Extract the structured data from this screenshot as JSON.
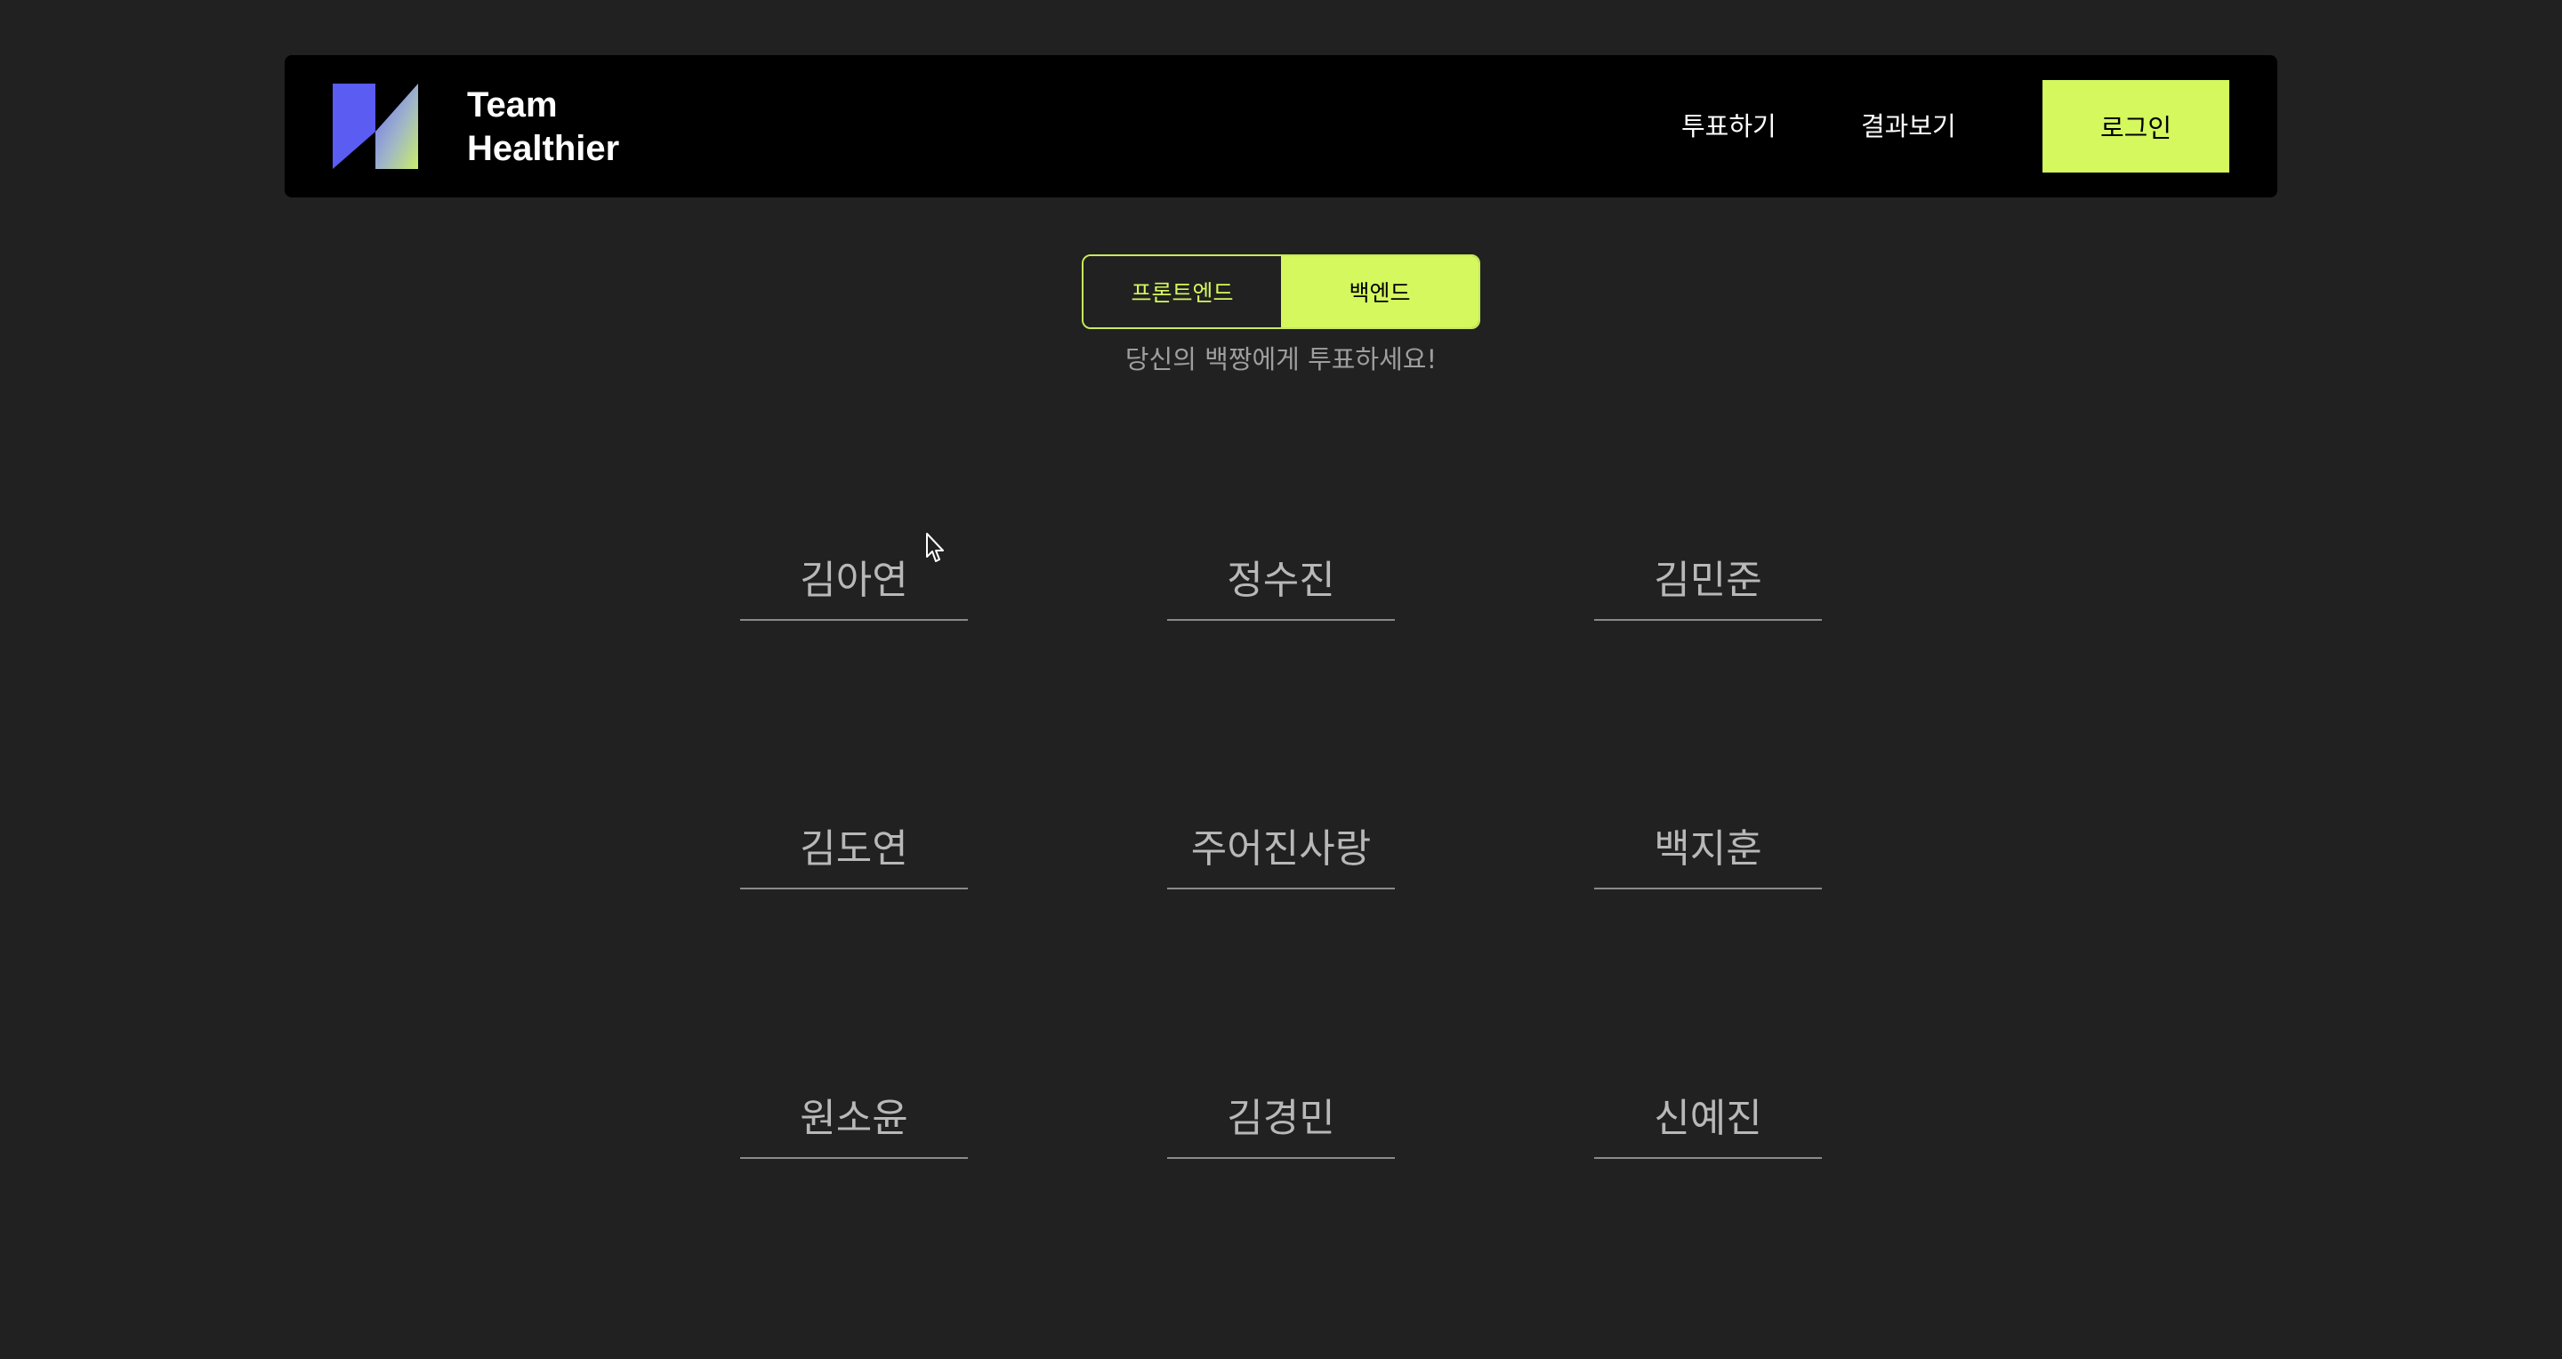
{
  "header": {
    "brand_line1": "Team",
    "brand_line2": "Healthier",
    "nav_vote": "투표하기",
    "nav_results": "결과보기",
    "login_label": "로그인",
    "logo_icon": "team-healthier-logo-icon"
  },
  "toggle": {
    "front_label": "프론트엔드",
    "back_label": "백엔드",
    "selected": "백엔드"
  },
  "subtitle": "당신의 백짱에게 투표하세요!",
  "candidates": [
    {
      "name": "김아연"
    },
    {
      "name": "정수진"
    },
    {
      "name": "김민준"
    },
    {
      "name": "김도연"
    },
    {
      "name": "주어진사랑"
    },
    {
      "name": "백지훈"
    },
    {
      "name": "원소윤"
    },
    {
      "name": "김경민"
    },
    {
      "name": "신예진"
    }
  ],
  "colors": {
    "background": "#212121",
    "header_bg": "#000000",
    "accent": "#d4f85e",
    "logo_blue": "#5b5bf0"
  }
}
